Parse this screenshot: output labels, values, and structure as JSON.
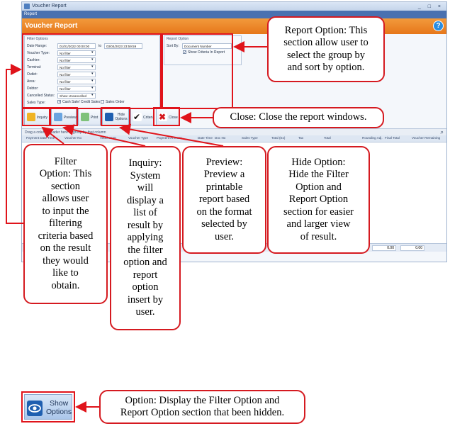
{
  "window": {
    "title": "Voucher Report",
    "menu": "Report",
    "header": "Voucher Report",
    "controls": "_ □ ×"
  },
  "filter_options": {
    "title": "Filter Options",
    "date_range": {
      "label": "Date Range:",
      "from": "01/01/2022 00:00:00",
      "to_label": "to",
      "to": "03/04/2023 23:59:59"
    },
    "rows": [
      {
        "label": "Voucher Type:",
        "value": "No filter"
      },
      {
        "label": "Cashier:",
        "value": "No filter"
      },
      {
        "label": "Terminal:",
        "value": "No filter"
      },
      {
        "label": "Outlet:",
        "value": "No filter"
      },
      {
        "label": "Area:",
        "value": "No filter"
      },
      {
        "label": "Debtor:",
        "value": "No filter"
      },
      {
        "label": "Cancelled Status:",
        "value": "Show Uncancelled"
      }
    ],
    "sales_type": {
      "label": "Sales Type:",
      "opt1": "Cash Sale/ Credit Sales",
      "opt2": "Sales Order"
    }
  },
  "report_option": {
    "title": "Report Option",
    "sort_label": "Sort By:",
    "sort_value": "Document Number",
    "criteria": "Show Criteria In Report"
  },
  "toolbar": {
    "inquiry": "Inquiry",
    "preview": "Preview",
    "print": "Print",
    "hide": "Hide Options",
    "criteria": "Criteria",
    "close": "Close"
  },
  "grid": {
    "group_hint": "Drag a column header here to group by that column",
    "columns": [
      "Payment Date Time",
      "Voucher No",
      "Voucher ID",
      "Voucher Type",
      "Payment Amount",
      "Date Time",
      "Doc No",
      "Sales Type",
      "Total (Ex)",
      "Tax",
      "Total",
      "Rounding Adj.",
      "Final Total",
      "Voucher Remaining"
    ],
    "footer_values": [
      "0.00",
      "0.00"
    ]
  },
  "callouts": {
    "report_option": "Report Option: This\nsection allow user to\nselect the group by\nand sort by option.",
    "close": "Close: Close the report windows.",
    "filter": "Filter\nOption: This\nsection\nallows user\nto input the\nfiltering\ncriteria based\non the result\nthey would\nlike to\nobtain.",
    "inquiry": "Inquiry:\nSystem\nwill\ndisplay a\nlist of\nresult by\napplying\nthe filter\noption and\nreport\noption\ninsert by\nuser.",
    "preview": "Preview:\nPreview a\nprintable\nreport based\non the format\nselected by\nuser.",
    "hide": "Hide Option:\nHide the Filter\nOption and\nReport Option\nsection for easier\nand larger view\nof result.",
    "show": "Option: Display the Filter Option and\nReport Option section that been hidden."
  },
  "show_options_button": "Show\nOptions",
  "colors": {
    "header": "#e6771a",
    "callout_border": "#d51a20",
    "menubar": "#4a71b0"
  }
}
